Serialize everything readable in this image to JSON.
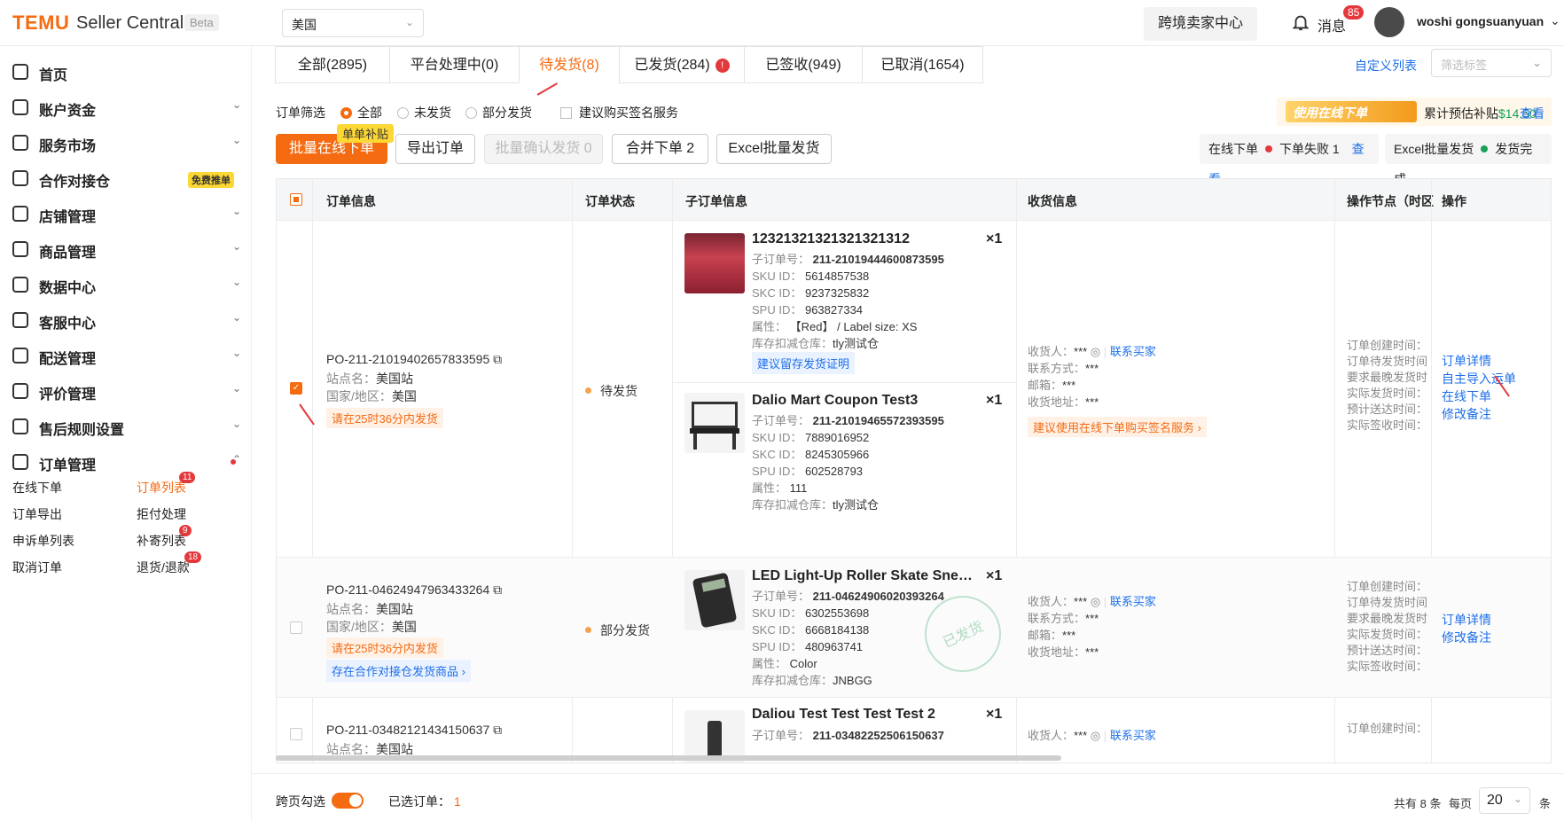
{
  "header": {
    "logo": "TEMU",
    "brand": "Seller Central",
    "beta": "Beta",
    "region": "美国",
    "crossborder_center": "跨境卖家中心",
    "messages_label": "消息",
    "messages_count": "85",
    "username": "woshi gongsuanyuan"
  },
  "sidebar": {
    "items": [
      {
        "label": "首页"
      },
      {
        "label": "账户资金"
      },
      {
        "label": "服务市场"
      },
      {
        "label": "合作对接仓",
        "badge": "免费推单"
      },
      {
        "label": "店铺管理"
      },
      {
        "label": "商品管理"
      },
      {
        "label": "数据中心"
      },
      {
        "label": "客服中心"
      },
      {
        "label": "配送管理"
      },
      {
        "label": "评价管理"
      },
      {
        "label": "售后规则设置"
      },
      {
        "label": "订单管理"
      }
    ],
    "subitems": [
      {
        "label": "在线下单"
      },
      {
        "label": "订单列表",
        "badge": "11"
      },
      {
        "label": "订单导出"
      },
      {
        "label": "拒付处理"
      },
      {
        "label": "申诉单列表"
      },
      {
        "label": "补寄列表",
        "badge": "9"
      },
      {
        "label": "取消订单"
      },
      {
        "label": "退货/退款",
        "badge": "18"
      }
    ]
  },
  "tabs": [
    {
      "label": "全部(2895)"
    },
    {
      "label": "平台处理中(0)"
    },
    {
      "label": "待发货(8)"
    },
    {
      "label": "已发货(284)"
    },
    {
      "label": "已签收(949)"
    },
    {
      "label": "已取消(1654)"
    }
  ],
  "custom_list": "自定义列表",
  "filter_tag_placeholder": "筛选标签",
  "filter": {
    "label": "订单筛选",
    "options": [
      "全部",
      "未发货",
      "部分发货"
    ],
    "signature": "建议购买签名服务"
  },
  "banner": {
    "image_text": "使用在线下单",
    "subsidy_label": "累计预估补贴",
    "subsidy_value": "$14.50",
    "view": "查看"
  },
  "toolbar": {
    "batch_online": "批量在线下单",
    "batch_tag": "单单补贴",
    "export": "导出订单",
    "batch_confirm": "批量确认发货 0",
    "merge": "合并下单  2",
    "excel": "Excel批量发货"
  },
  "status_online": {
    "label": "在线下单",
    "fail": "下单失败 1",
    "view": "查看"
  },
  "status_excel": {
    "label": "Excel批量发货",
    "done": "发货完成"
  },
  "table": {
    "headers": [
      "订单信息",
      "订单状态",
      "子订单信息",
      "收货信息",
      "操作节点（时区",
      "操作"
    ],
    "labels": {
      "site": "站点名：",
      "country": "国家/地区：",
      "sub_no": "子订单号：",
      "sku": "SKU ID：",
      "skc": "SKC ID：",
      "spu": "SPU ID：",
      "attr": "属性：",
      "warehouse": "库存扣减仓库：",
      "receiver": "收货人：",
      "contact": "联系方式：",
      "email": "邮箱：",
      "address": "收货地址：",
      "contact_buyer": "联系买家"
    },
    "op_nodes": [
      "订单创建时间：",
      "订单待发货时间",
      "要求最晚发货时",
      "实际发货时间：",
      "预计送达时间：",
      "实际签收时间："
    ],
    "orders": [
      {
        "po": "PO-211-21019402657833595",
        "site": "美国站",
        "country": "美国",
        "deadline": "请在25时36分内发货",
        "status": "待发货",
        "masked": "***",
        "suggest": "建议使用在线下单购买签名服务",
        "actions": [
          "订单详情",
          "自主导入运单",
          "在线下单",
          "修改备注"
        ],
        "subs": [
          {
            "title": "12321321321321321312",
            "qty": "×1",
            "sub_no": "211-21019444600873595",
            "sku": "5614857538",
            "skc": "9237325832",
            "spu": "963827334",
            "attr": "【Red】 / Label size: XS",
            "warehouse": "tly测试仓",
            "proof": "建议留存发货证明"
          },
          {
            "title": "Dalio Mart Coupon Test3",
            "qty": "×1",
            "sub_no": "211-21019465572393595",
            "sku": "7889016952",
            "skc": "8245305966",
            "spu": "602528793",
            "attr": "111",
            "warehouse": "tly测试仓"
          }
        ]
      },
      {
        "po": "PO-211-04624947963433264",
        "site": "美国站",
        "country": "美国",
        "deadline": "请在25时36分内发货",
        "partner": "存在合作对接仓发货商品",
        "status": "部分发货",
        "masked": "***",
        "stamp": "已发货",
        "actions": [
          "订单详情",
          "修改备注"
        ],
        "subs": [
          {
            "title": "LED Light-Up Roller Skate Sneakers",
            "qty": "×1",
            "sub_no": "211-04624906020393264",
            "sku": "6302553698",
            "skc": "6668184138",
            "spu": "480963741",
            "attr": "Color",
            "warehouse": "JNBGG"
          }
        ]
      },
      {
        "po": "PO-211-03482121434150637",
        "site": "美国站",
        "masked": "***",
        "subs": [
          {
            "title": "Daliou Test Test Test Test 2",
            "qty": "×1",
            "sub_no": "211-03482252506150637"
          }
        ]
      }
    ]
  },
  "footer": {
    "cross_page": "跨页勾选",
    "selected_label": "已选订单：",
    "selected_count": "1",
    "total": "共有 8 条",
    "per_page_label": "每页",
    "per_page": "20",
    "unit": "条"
  },
  "colors": {
    "accent": "#f46b12",
    "link": "#1d6fe8",
    "danger": "#e4393c"
  }
}
